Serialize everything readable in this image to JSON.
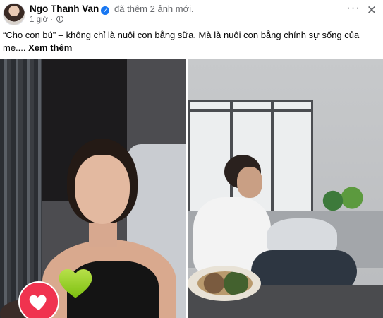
{
  "post": {
    "author": "Ngo Thanh Van",
    "action": "đã thêm 2 ảnh mới.",
    "timestamp": "1 giờ",
    "separator": "·",
    "audience_icon": "globe-icon",
    "more_icon": "more-options-icon",
    "more_label": "···",
    "close_label": "✕",
    "caption": "“Cho con bú” – không chỉ là nuôi con bằng sữa. Mà là nuôi con bằng chính sự sống của mẹ.... ",
    "see_more": "Xem thêm"
  },
  "photos": [
    {
      "name": "photo-left",
      "reactions": [
        "heart-reaction",
        "green-heart"
      ]
    },
    {
      "name": "photo-right"
    }
  ],
  "colors": {
    "verified": "#1877f2",
    "heart": "#f0334f",
    "green_heart": "#8ccc14",
    "meta_text": "#65676b"
  }
}
